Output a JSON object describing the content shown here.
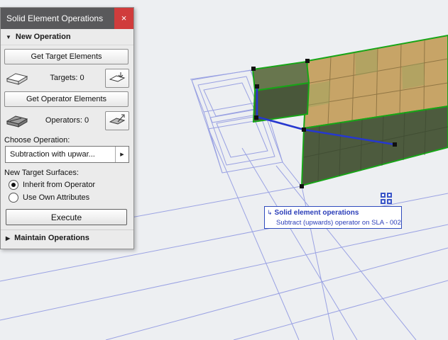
{
  "colors": {
    "selection_green": "#17a517",
    "operator_blue": "#2638cf",
    "wireframe_blue": "#99a1e2",
    "titlebar_gray": "#59595b",
    "close_red": "#d03c3c",
    "tag_blue": "#2a3db8",
    "deck_tan": "#c7a467",
    "deck_side_olive": "#4d5b3e"
  },
  "palette": {
    "title": "Solid Element Operations",
    "icons": {
      "close": "×",
      "expanded": "▼",
      "collapsed": "▶",
      "dropdown_arrow": "▶"
    },
    "sections": {
      "new_operation": "New Operation",
      "maintain_operations": "Maintain Operations"
    },
    "buttons": {
      "get_targets": "Get Target Elements",
      "get_operators": "Get Operator Elements",
      "execute": "Execute"
    },
    "counters": {
      "targets": "Targets: 0",
      "operators": "Operators: 0"
    },
    "labels": {
      "choose_operation": "Choose Operation:",
      "new_target_surfaces": "New Target Surfaces:"
    },
    "operation_dropdown": {
      "value": "Subtraction with upwar..."
    },
    "radios": [
      {
        "label": "Inherit from Operator",
        "selected": true
      },
      {
        "label": "Use Own Attributes",
        "selected": false
      }
    ]
  },
  "viewport": {
    "tag": {
      "bullet": "↳",
      "title": "Solid element operations",
      "detail": "Subtract (upwards) operator on SLA - 002"
    }
  }
}
